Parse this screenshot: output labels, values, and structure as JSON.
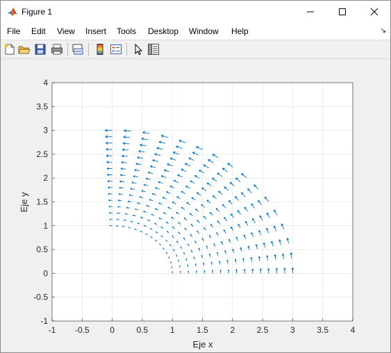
{
  "window": {
    "title": "Figure 1",
    "controls": [
      "minimize",
      "maximize",
      "close"
    ]
  },
  "menubar": {
    "items": [
      "File",
      "Edit",
      "View",
      "Insert",
      "Tools",
      "Desktop",
      "Window",
      "Help"
    ]
  },
  "toolbar": {
    "icons": [
      "new-figure-icon",
      "open-file-icon",
      "save-icon",
      "print-icon",
      "link-plot-icon",
      "insert-colorbar-icon",
      "insert-legend-icon",
      "pointer-icon",
      "property-inspector-icon"
    ]
  },
  "colors": {
    "arrow": "#0072bd",
    "grid": "#dfdfdf",
    "axes_background": "#ffffff",
    "figure_background": "#f0f0f0"
  },
  "chart_data": {
    "type": "quiver",
    "title": "",
    "xlabel": "Eje x",
    "ylabel": "Eje y",
    "xlim": [
      -1,
      4
    ],
    "ylim": [
      -1,
      4
    ],
    "xticks": [
      "-1",
      "-0.5",
      "0",
      "0.5",
      "1",
      "1.5",
      "2",
      "2.5",
      "3",
      "3.5",
      "4"
    ],
    "yticks": [
      "-1",
      "-0.5",
      "0",
      "0.5",
      "1",
      "1.5",
      "2",
      "2.5",
      "3",
      "3.5",
      "4"
    ],
    "grid": true,
    "field": {
      "description": "Vector field F = (-y, x) sampled on a polar grid",
      "r_range": [
        1,
        3
      ],
      "r_samples": 16,
      "theta_range_deg": [
        0,
        90
      ],
      "theta_samples": 16,
      "vector": [
        "-y",
        "x"
      ],
      "autoscale": 0.9
    }
  }
}
